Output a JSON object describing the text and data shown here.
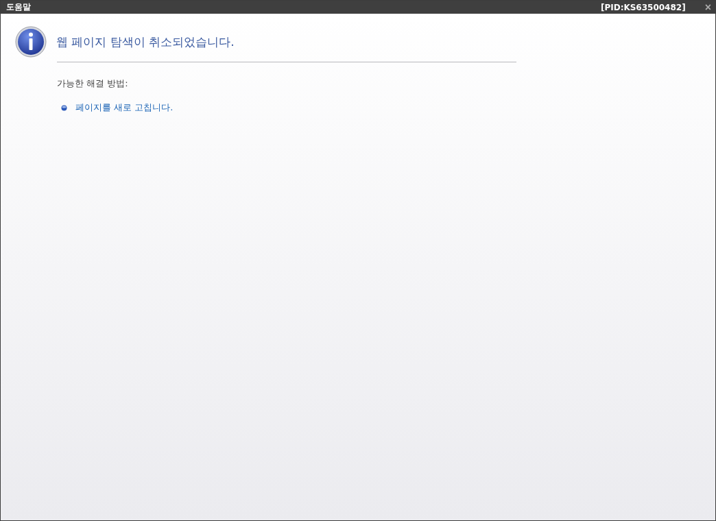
{
  "window": {
    "title": "도움말",
    "pid": "[PID:KS63500482]",
    "close": "×"
  },
  "message": {
    "heading": "웹 페이지 탐색이 취소되었습니다.",
    "subheading": "가능한 해결 방법:",
    "actions": [
      "페이지를 새로 고칩니다."
    ]
  }
}
